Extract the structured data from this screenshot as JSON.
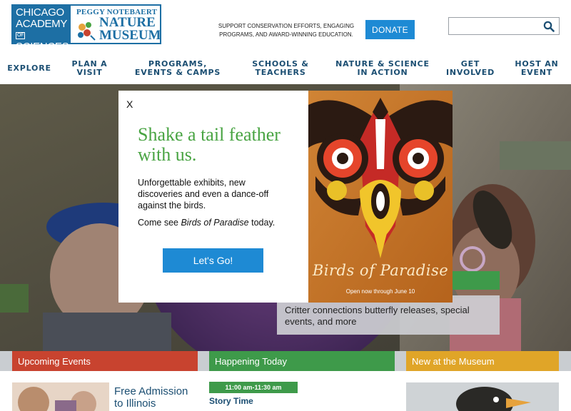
{
  "logo": {
    "left_lines": [
      "CHICAGO",
      "ACADEMY",
      "SCIENCES"
    ],
    "of": "OF",
    "peggy": "PEGGY NOTEBAERT",
    "nature": "NATURE",
    "museum": "MUSEUM"
  },
  "header": {
    "tagline": "SUPPORT CONSERVATION EFFORTS, ENGAGING PROGRAMS, AND AWARD-WINNING EDUCATION.",
    "donate_label": "DONATE",
    "search_value": "",
    "search_placeholder": ""
  },
  "nav": [
    {
      "label": "EXPLORE"
    },
    {
      "label": "PLAN A VISIT"
    },
    {
      "label": "PROGRAMS, EVENTS & CAMPS"
    },
    {
      "label": "SCHOOLS & TEACHERS"
    },
    {
      "label": "NATURE & SCIENCE IN ACTION"
    },
    {
      "label": "GET INVOLVED"
    },
    {
      "label": "HOST AN EVENT"
    }
  ],
  "hero": {
    "caption": "Critter connections butterfly releases, special events, and more"
  },
  "modal": {
    "close": "X",
    "heading": "Shake a tail feather with us.",
    "body": "Unforgettable exhibits, new discoveries and even a dance-off against the birds.",
    "body2_prefix": "Come see ",
    "body2_em": "Birds of Paradise",
    "body2_suffix": " today.",
    "button": "Let's Go!",
    "poster_title": "Birds of Paradise",
    "poster_sub": "Open now through June 10"
  },
  "columns": [
    {
      "title": "Upcoming Events",
      "color": "#c8432f"
    },
    {
      "title": "Happening Today",
      "color": "#3e9a4a"
    },
    {
      "title": "New at the Museum",
      "color": "#e0a528"
    }
  ],
  "upcoming": {
    "title": "Free Admission to Illinois Residents"
  },
  "today": {
    "time": "11:00 am-11:30 am",
    "title": "Story Time"
  },
  "colors": {
    "brand_blue": "#1d6fa4",
    "button_blue": "#1e8ad4",
    "green": "#49a443",
    "nav_text": "#1b4e72"
  }
}
